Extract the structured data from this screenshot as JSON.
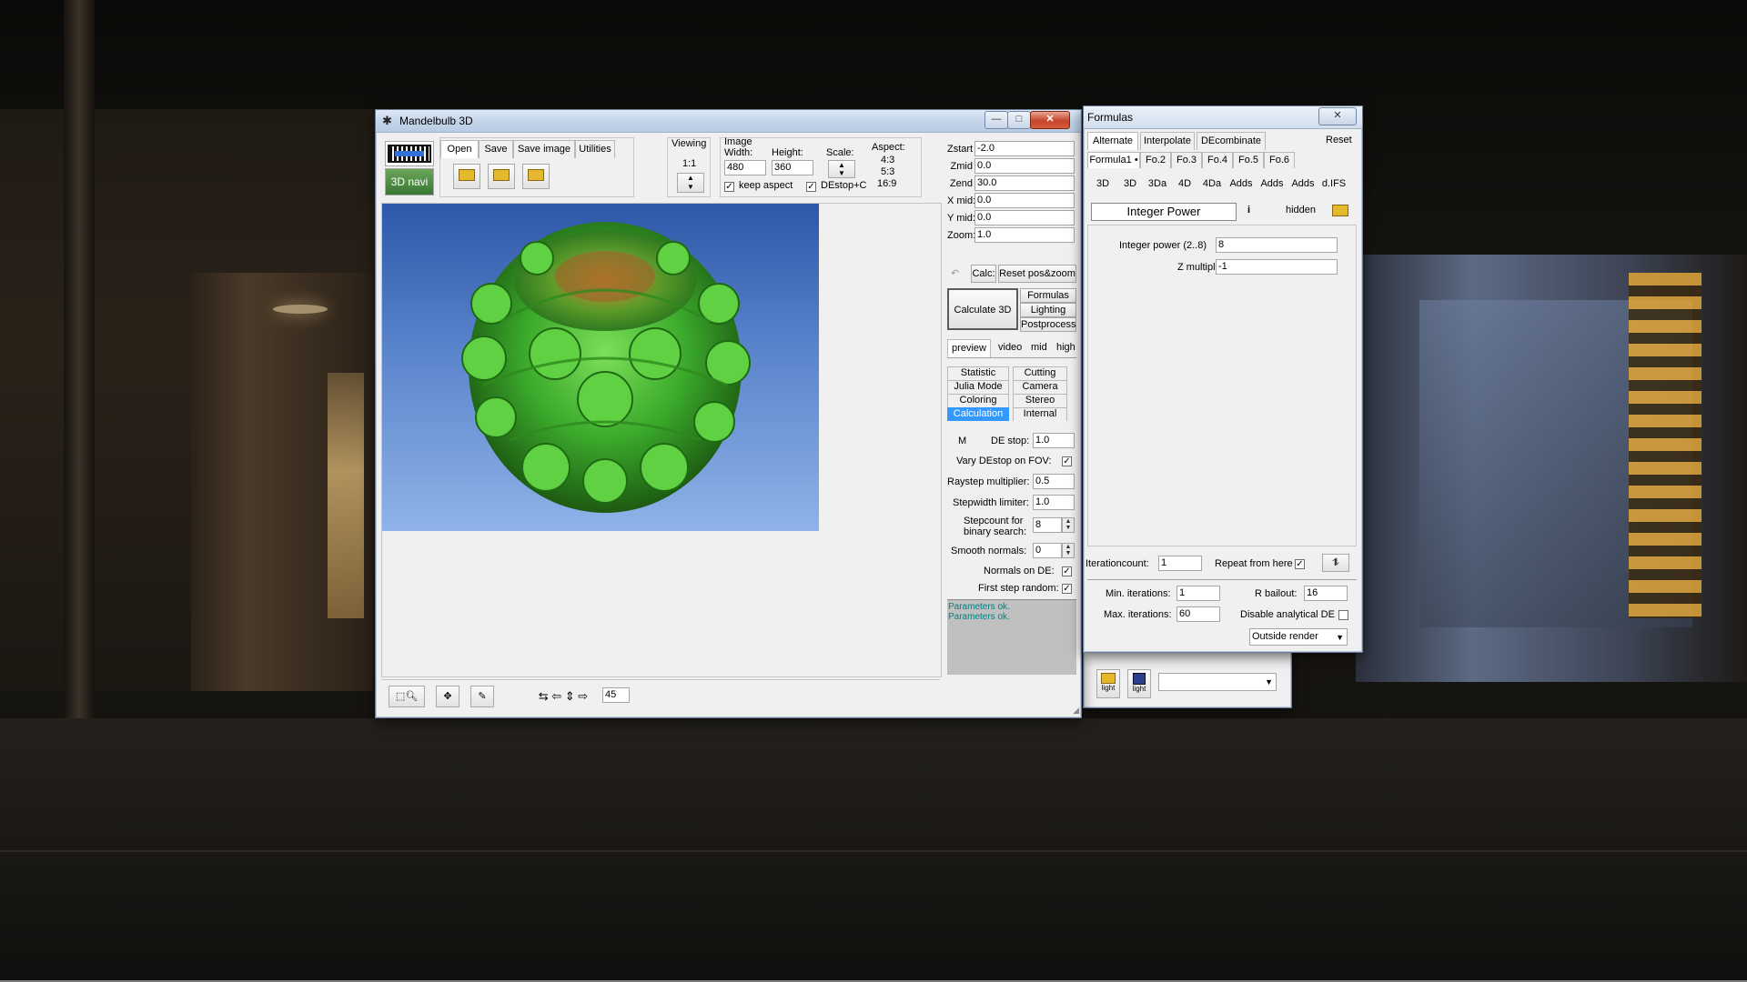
{
  "main_window": {
    "title": "Mandelbulb 3D",
    "controls": {
      "minimize": "—",
      "maximize": "□",
      "close": "✕"
    },
    "menu": {
      "open": "Open",
      "save": "Save",
      "save_image": "Save image",
      "utilities": "Utilities"
    },
    "navi_label": "3D navi",
    "viewing": {
      "label": "Viewing",
      "value": "1:1"
    },
    "image": {
      "label": "Image",
      "width_label": "Width:",
      "width": "480",
      "height_label": "Height:",
      "height": "360",
      "scale_label": "Scale:",
      "aspect_label": "Aspect:",
      "aspects": [
        "4:3",
        "5:3",
        "16:9"
      ],
      "keep_aspect": "keep aspect",
      "destop_c": "DEstop+C"
    },
    "coords": [
      {
        "label": "Zstart",
        "value": "-2.0"
      },
      {
        "label": "Zmid",
        "value": "0.0"
      },
      {
        "label": "Zend",
        "value": "30.0"
      },
      {
        "label": "X mid:",
        "value": "0.0"
      },
      {
        "label": "Y mid:",
        "value": "0.0"
      },
      {
        "label": "Zoom:",
        "value": "1.0"
      }
    ],
    "calc_label": "Calc:",
    "reset_poszoom": "Reset pos&zoom",
    "calculate_3d": "Calculate 3D",
    "side_buttons": [
      "Formulas",
      "Lighting",
      "Postprocess"
    ],
    "quality_tabs": [
      "preview",
      "video",
      "mid",
      "high"
    ],
    "panel_tabs": [
      [
        "Statistic",
        "Cutting"
      ],
      [
        "Julia Mode",
        "Camera"
      ],
      [
        "Coloring",
        "Stereo"
      ],
      [
        "Calculation",
        "Internal"
      ]
    ],
    "calc_params": {
      "m_label": "M",
      "destop_label": "DE stop:",
      "destop": "1.0",
      "vary_label": "Vary DEstop on FOV:",
      "raystep_label": "Raystep multiplier:",
      "raystep": "0.5",
      "stepwidth_label": "Stepwidth limiter:",
      "stepwidth": "1.0",
      "stepcount_label1": "Stepcount for",
      "stepcount_label2": "binary search:",
      "stepcount": "8",
      "smooth_label": "Smooth  normals:",
      "smooth": "0",
      "normals_label": "Normals on DE:",
      "firststep_label": "First step random:"
    },
    "status": [
      "Parameters ok.",
      "Parameters ok."
    ],
    "bottom": {
      "angle": "45"
    }
  },
  "formulas_window": {
    "title": "Formulas",
    "close": "✕",
    "top_tabs": [
      "Alternate",
      "Interpolate",
      "DEcombinate"
    ],
    "reset": "Reset",
    "formula_tabs": [
      "Formula1 •",
      "Fo.2",
      "Fo.3",
      "Fo.4",
      "Fo.5",
      "Fo.6"
    ],
    "cat_tabs": [
      "3D",
      "3D",
      "3Da",
      "4D",
      "4Da",
      "Adds",
      "Adds",
      "Adds",
      "d.IFS"
    ],
    "formula_name": "Integer Power",
    "info": "i",
    "hidden": "hidden",
    "params": [
      {
        "label": "Integer power (2..8)",
        "value": "8"
      },
      {
        "label": "Z multiplier",
        "value": "-1"
      }
    ],
    "iteration_label": "Iterationcount:",
    "iteration": "1",
    "repeat_label": "Repeat from here",
    "min_iter_label": "Min. iterations:",
    "min_iter": "1",
    "rbailout_label": "R bailout:",
    "rbailout": "16",
    "max_iter_label": "Max. iterations:",
    "max_iter": "60",
    "disable_de_label": "Disable analytical DE",
    "outside_render": "Outside render"
  },
  "lighting_strip": {
    "light1": "light",
    "light2": "light"
  },
  "colors": {
    "accent": "#3399ff",
    "status_text": "#008080",
    "render_sky_top": "#2e57a8",
    "render_sky_bottom": "#8fb3e8"
  }
}
